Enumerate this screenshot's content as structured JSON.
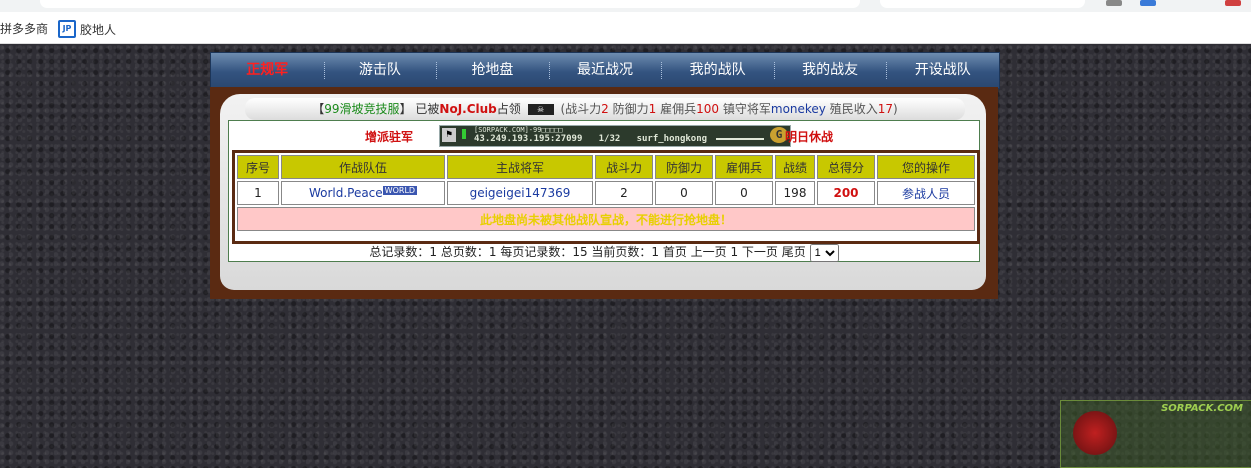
{
  "bookmarks": [
    {
      "label": "拼多多商"
    },
    {
      "label": "胶地人"
    }
  ],
  "nav": {
    "items": [
      "正规军",
      "游击队",
      "抢地盘",
      "最近战况",
      "我的战队",
      "我的战友",
      "开设战队"
    ],
    "active_index": 0
  },
  "status": {
    "server_name": "99滑坡竞技服",
    "occupied_prefix": "已被",
    "occupier": "NoJ.Club",
    "occupied_suffix": "占领",
    "attack_label": "战斗力",
    "attack_value": "2",
    "defense_label": "防御力",
    "defense_value": "1",
    "mercenary_label": "雇佣兵",
    "mercenary_value": "100",
    "guard_label": "镇守将军",
    "guard_name": "monekey",
    "income_label": "殖民收入",
    "income_value": "17"
  },
  "actions": {
    "reinforce": "增派驻军",
    "tomorrow": "明日休战"
  },
  "server_banner": {
    "title": "[SORPACK.COM]-99□□□□□",
    "address": "43.249.193.195:27099",
    "players": "1/32",
    "map": "surf_hongkong"
  },
  "table": {
    "headers": [
      "序号",
      "作战队伍",
      "主战将军",
      "战斗力",
      "防御力",
      "雇佣兵",
      "战绩",
      "总得分",
      "您的操作"
    ],
    "rows": [
      {
        "index": "1",
        "team": "World.Peace",
        "team_tag": "WORLD",
        "general": "geigeigei147369",
        "attack": "2",
        "defense": "0",
        "mercenary": "0",
        "record": "198",
        "score": "200",
        "action": "参战人员"
      }
    ],
    "notice": "此地盘尚未被其他战队宣战，不能进行抢地盘！"
  },
  "pager": {
    "text": "总记录数：1 总页数：1 每页记录数：15 当前页数：1 首页 上一页 1 下一页 尾页",
    "page_select": "1"
  },
  "watermark": {
    "site": "SORPACK.COM"
  },
  "colors": {
    "nav_bg": "#33537f",
    "panel_border": "#5a2a12",
    "header_yellow": "#c8c800",
    "accent_red": "#d01010"
  }
}
